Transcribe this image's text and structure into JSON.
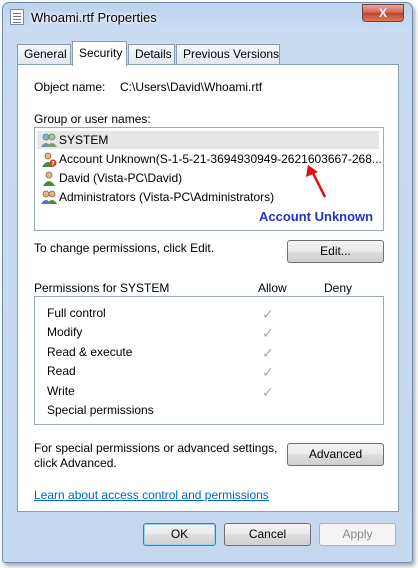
{
  "window": {
    "title": "Whoami.rtf Properties",
    "close_label": "X"
  },
  "tabs": [
    {
      "label": "General"
    },
    {
      "label": "Security"
    },
    {
      "label": "Details"
    },
    {
      "label": "Previous Versions"
    }
  ],
  "security": {
    "object_name_label": "Object name:",
    "object_name_value": "C:\\Users\\David\\Whoami.rtf",
    "group_label": "Group or user names:",
    "users": [
      {
        "name": "SYSTEM",
        "icon": "group-users-icon"
      },
      {
        "name": "Account Unknown(S-1-5-21-3694930949-2621603667-268...",
        "icon": "unknown-user-icon"
      },
      {
        "name": "David (Vista-PC\\David)",
        "icon": "user-icon"
      },
      {
        "name": "Administrators (Vista-PC\\Administrators)",
        "icon": "group-users-icon"
      }
    ],
    "annotation": "Account Unknown",
    "change_text": "To change permissions, click Edit.",
    "edit_label": "Edit...",
    "perms_header": "Permissions for SYSTEM",
    "allow_label": "Allow",
    "deny_label": "Deny",
    "permissions": [
      {
        "name": "Full control",
        "allow": true
      },
      {
        "name": "Modify",
        "allow": true
      },
      {
        "name": "Read & execute",
        "allow": true
      },
      {
        "name": "Read",
        "allow": true
      },
      {
        "name": "Write",
        "allow": true
      },
      {
        "name": "Special permissions",
        "allow": false
      }
    ],
    "check_glyph": "✓",
    "special_text_line1": "For special permissions or advanced settings,",
    "special_text_line2": "click Advanced.",
    "advanced_label": "Advanced",
    "learn_link": "Learn about access control and permissions"
  },
  "footer": {
    "ok_label": "OK",
    "cancel_label": "Cancel",
    "apply_label": "Apply"
  },
  "colors": {
    "annotation": "#2233cc",
    "arrow": "#e01010",
    "link": "#0066cc"
  }
}
